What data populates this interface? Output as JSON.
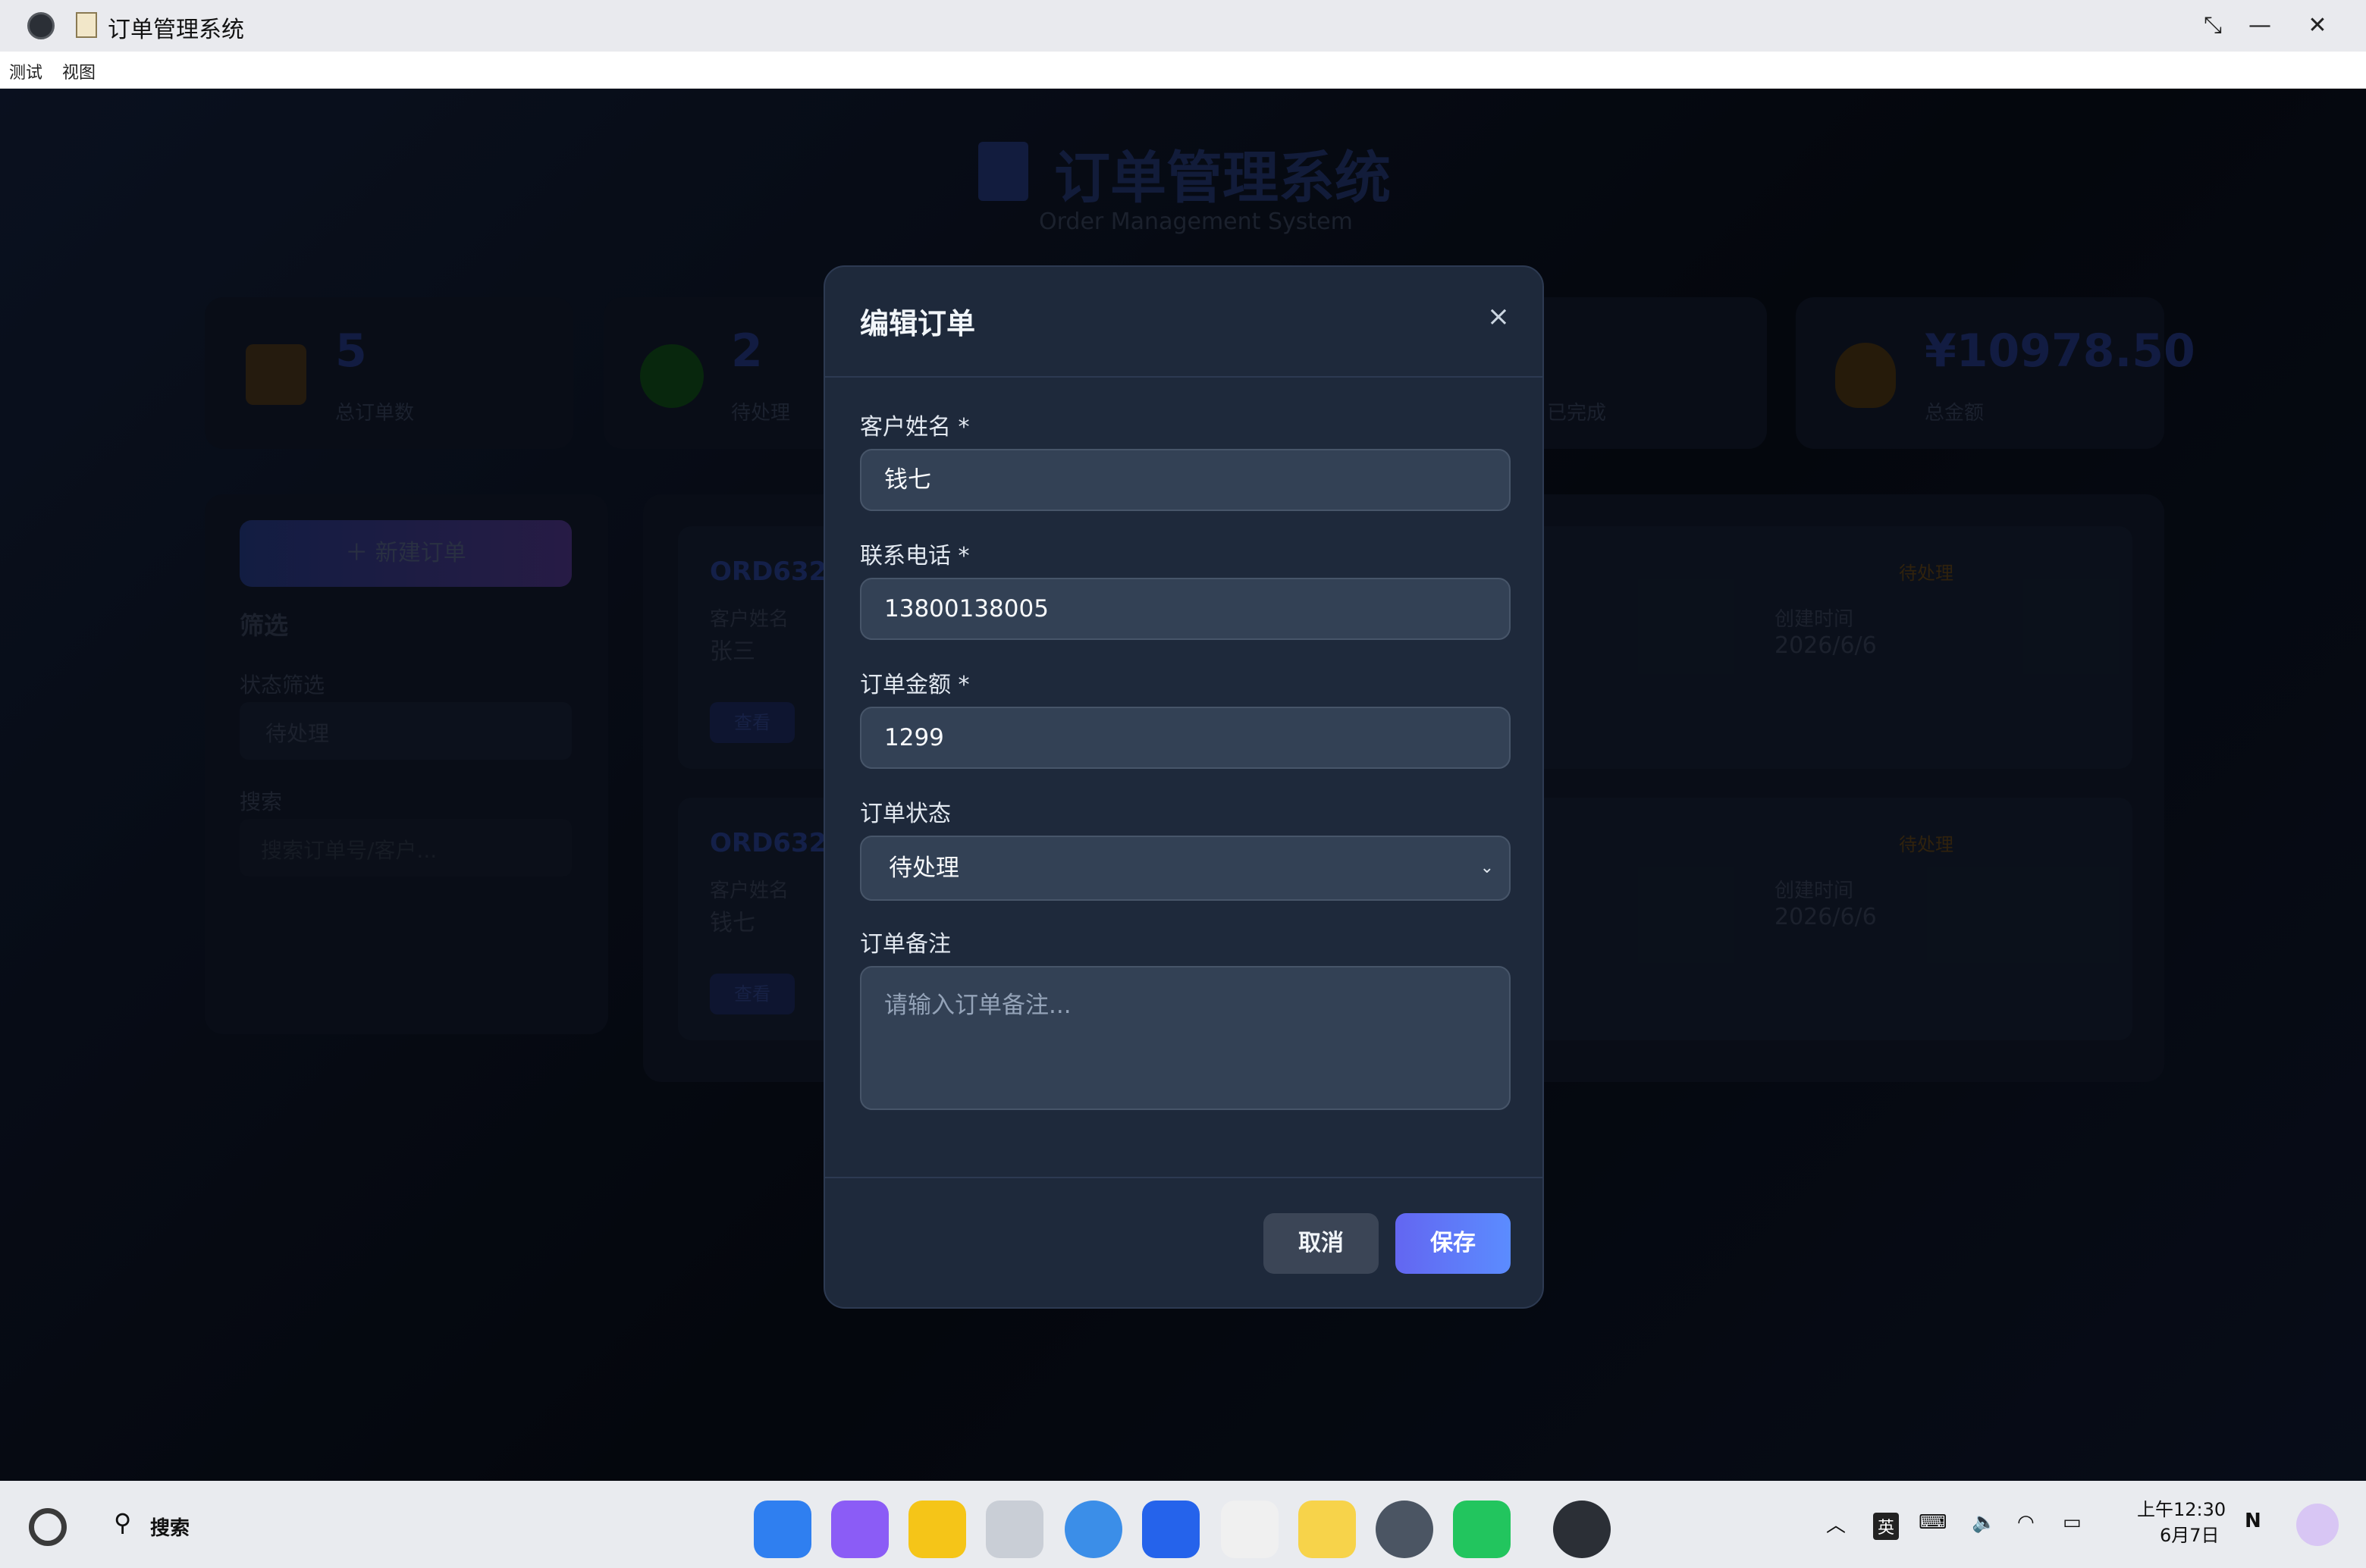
{
  "window": {
    "title": "订单管理系统",
    "menu": [
      "测试",
      "视图"
    ]
  },
  "app": {
    "title": "订单管理系统",
    "subtitle": "Order Management System",
    "stats": [
      {
        "value": "5",
        "label": "总订单数"
      },
      {
        "value": "2",
        "label": "待处理"
      },
      {
        "value": "",
        "label": "已完成"
      },
      {
        "value": "¥10978.50",
        "label": "总金额"
      }
    ],
    "sidebar": {
      "new_order": "＋ 新建订单",
      "filter_title": "筛选",
      "status_label": "状态筛选",
      "status_value": "待处理",
      "search_label": "搜索",
      "search_placeholder": "搜索订单号/客户..."
    },
    "orders": [
      {
        "id": "ORD6324",
        "customer_label": "客户姓名",
        "customer": "张三",
        "created_label": "创建时间",
        "created": "2026/6/6",
        "status": "待处理",
        "view": "查看"
      },
      {
        "id": "ORD6324",
        "customer_label": "客户姓名",
        "customer": "钱七",
        "created_label": "创建时间",
        "created": "2026/6/6",
        "status": "待处理",
        "view": "查看"
      }
    ]
  },
  "modal": {
    "title": "编辑订单",
    "close": "×",
    "fields": {
      "name_label": "客户姓名 *",
      "name_value": "钱七",
      "phone_label": "联系电话 *",
      "phone_value": "13800138005",
      "amount_label": "订单金额 *",
      "amount_value": "1299",
      "status_label": "订单状态",
      "status_value": "待处理",
      "note_label": "订单备注",
      "note_placeholder": "请输入订单备注..."
    },
    "cancel": "取消",
    "save": "保存"
  },
  "taskbar": {
    "search": "搜索",
    "ime": "英",
    "time": "上午12:30",
    "date": "6月7日"
  }
}
